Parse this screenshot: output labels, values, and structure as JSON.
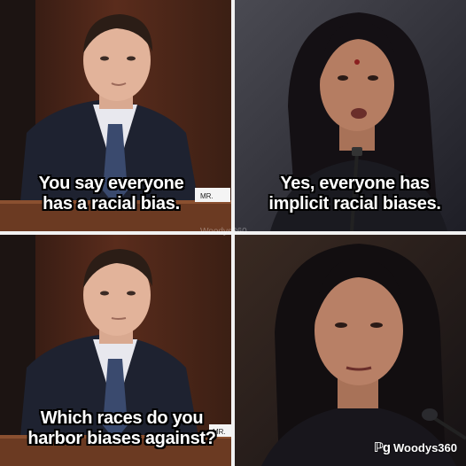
{
  "panels": {
    "top_left": {
      "caption_lines": [
        "You say everyone",
        "has a racial bias."
      ],
      "nameplate": "MR."
    },
    "top_right": {
      "caption_lines": [
        "Yes, everyone has",
        "implicit racial biases."
      ]
    },
    "bottom_left": {
      "caption_lines": [
        "Which races do you",
        "harbor biases against?"
      ],
      "nameplate": "MR."
    },
    "bottom_right": {}
  },
  "watermarks": {
    "center": "Woodys360",
    "corner_logo": "ℙg",
    "corner_text": "Woodys360"
  }
}
